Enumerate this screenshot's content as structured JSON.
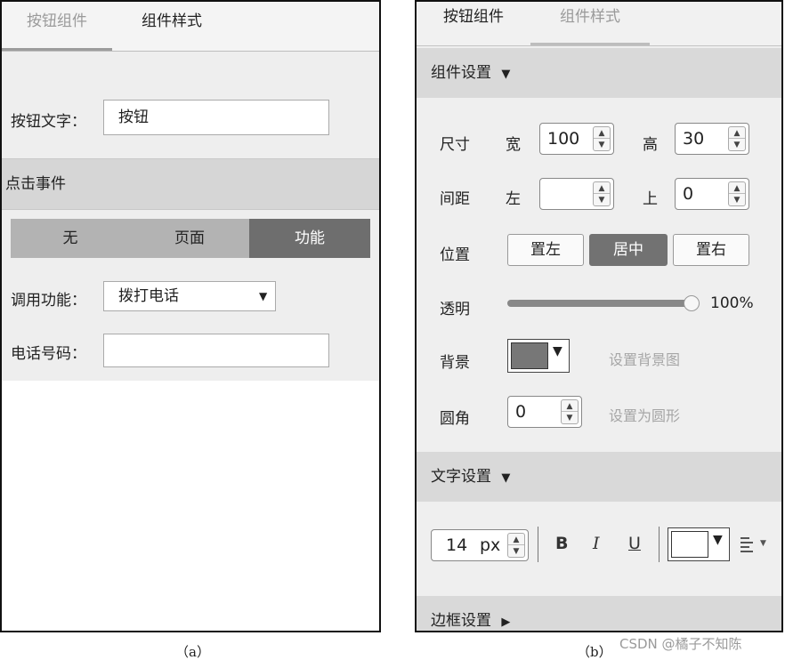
{
  "panel_a": {
    "tabs": [
      {
        "label": "按钮组件",
        "active": false
      },
      {
        "label": "组件样式",
        "active": true
      }
    ],
    "button_text_label": "按钮文字：",
    "button_text_value": "按钮",
    "click_event_section": "点击事件",
    "event_types": [
      {
        "label": "无",
        "selected": false
      },
      {
        "label": "页面",
        "selected": false
      },
      {
        "label": "功能",
        "selected": true
      }
    ],
    "call_function_label": "调用功能：",
    "call_function_value": "拨打电话",
    "phone_label": "电话号码：",
    "phone_value": "",
    "caption": "（a）"
  },
  "panel_b": {
    "tabs": [
      {
        "label": "按钮组件",
        "active": true
      },
      {
        "label": "组件样式",
        "active": false
      }
    ],
    "component_settings_label": "组件设置",
    "size_label": "尺寸",
    "width_label": "宽",
    "width_value": "100",
    "height_label": "高",
    "height_value": "30",
    "spacing_label": "间距",
    "left_label": "左",
    "left_value": "",
    "top_label": "上",
    "top_value": "0",
    "position_label": "位置",
    "position_options": [
      {
        "label": "置左",
        "selected": false
      },
      {
        "label": "居中",
        "selected": true
      },
      {
        "label": "置右",
        "selected": false
      }
    ],
    "opacity_label": "透明",
    "opacity_value": "100%",
    "opacity_level": 1.0,
    "background_label": "背景",
    "background_color": "#777777",
    "set_background_image_link": "设置背景图",
    "corner_label": "圆角",
    "corner_value": "0",
    "set_round_link": "设置为圆形",
    "text_settings_label": "文字设置",
    "font_size_value": "14",
    "font_size_unit": "px",
    "bold_label": "B",
    "italic_label": "I",
    "underline_label": "U",
    "text_color": "#ffffff",
    "border_settings_label": "边框设置",
    "caption": "（b）"
  },
  "watermark": "CSDN @橘子不知陈"
}
